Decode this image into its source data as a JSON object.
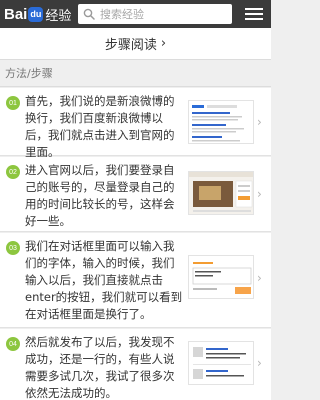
{
  "header": {
    "logo_bai": "Bai",
    "logo_du": "du",
    "logo_jingyan": "经验",
    "search_placeholder": "搜索经验"
  },
  "step_reading": {
    "label": "步骤阅读",
    "chevron": "›"
  },
  "section_title": "方法/步骤",
  "steps": [
    {
      "num": "01",
      "text": "首先，我们说的是新浪微博的换行，我们百度新浪微博以后，我们就点击进入到官网的里面。",
      "thumb": "search-results-screenshot"
    },
    {
      "num": "02",
      "text": "进入官网以后，我们要登录自己的账号的，尽量登录自己的用的时间比较长的号，这样会好一些。",
      "thumb": "weibo-homepage-screenshot"
    },
    {
      "num": "03",
      "text": "我们在对话框里面可以输入我们的字体，输入的时候，我们输入以后，我们直接就点击enter的按钮，我们就可以看到在对话框里面是换行了。",
      "thumb": "compose-box-screenshot"
    },
    {
      "num": "04",
      "text": "然后就发布了以后，我发现不成功，还是一行的，有些人说需要多试几次，我试了很多次依然无法成功的。",
      "thumb": "post-result-screenshot"
    }
  ],
  "colors": {
    "topbar": "#3b3b3b",
    "step_badge": "#8dc63f",
    "baidu_blue": "#2a6bd7"
  }
}
